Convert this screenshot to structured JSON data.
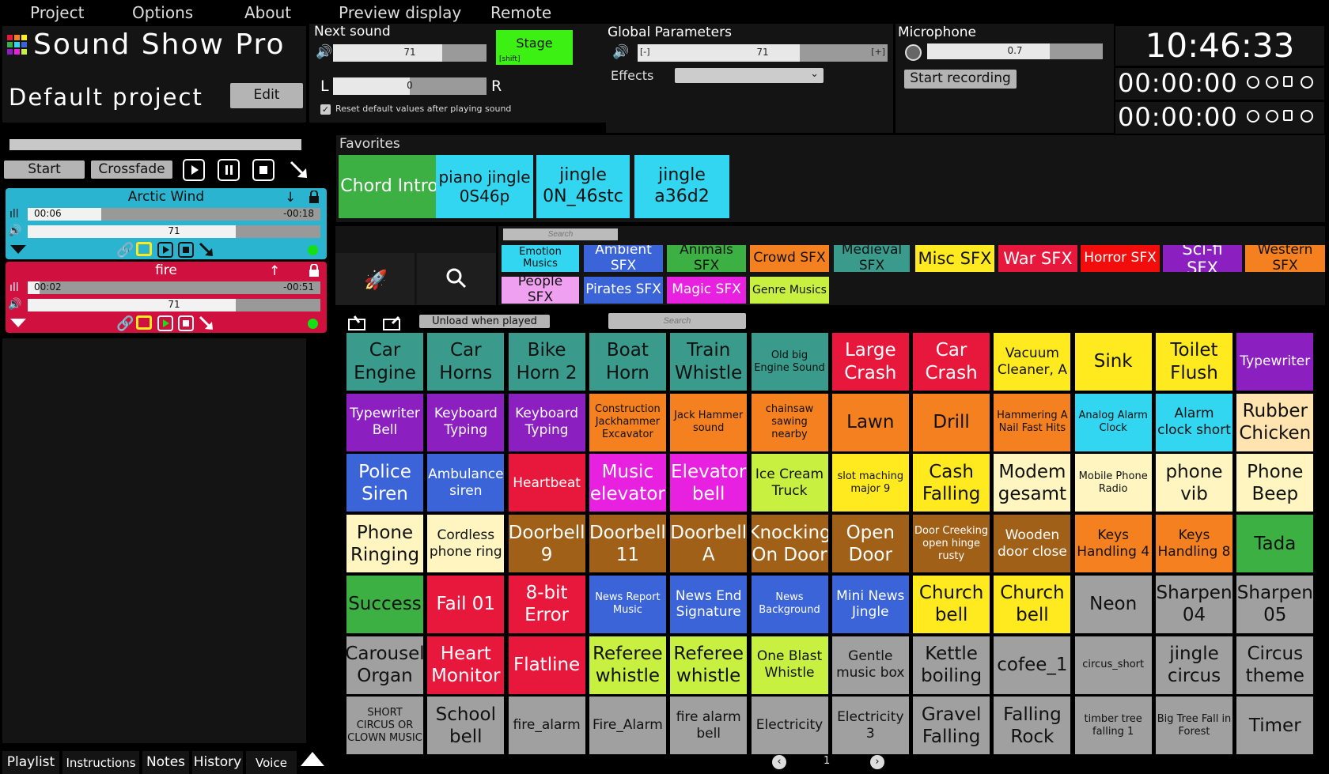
{
  "menu": [
    "Project",
    "Options",
    "About",
    "Preview display",
    "Remote"
  ],
  "app": {
    "title": "Sound Show Pro",
    "project": "Default project",
    "edit_label": "Edit"
  },
  "transport": {
    "start": "Start",
    "crossfade": "Crossfade"
  },
  "next_sound": {
    "title": "Next sound",
    "volume": "71",
    "pan": "0",
    "pan_left": "L",
    "pan_right": "R",
    "stage": "Stage",
    "stage_hint": "[shift]",
    "reset_label": "Reset default values after playing sound"
  },
  "global": {
    "title": "Global Parameters",
    "volume": "71",
    "minus": "[-]",
    "plus": "[+]",
    "effects_label": "Effects",
    "effects_value": ""
  },
  "microphone": {
    "title": "Microphone",
    "level": "0.7",
    "record_label": "Start recording"
  },
  "clock": {
    "time": "10:46:33",
    "timer1": "00:00:00",
    "timer2": "00:00:00"
  },
  "players": [
    {
      "name": "Arctic Wind",
      "elapsed": "00:06",
      "remaining": "-00:18",
      "volume": "71",
      "color": "#2ab4d0",
      "progress": 0.25,
      "vol_fill": 0.71
    },
    {
      "name": "fire",
      "elapsed": "00:02",
      "remaining": "-00:51",
      "volume": "71",
      "color": "#d0103e",
      "progress": 0.04,
      "vol_fill": 0.71
    }
  ],
  "favorites": {
    "title": "Favorites",
    "items": [
      {
        "label": "Chord Intro",
        "color": "#3cb043"
      },
      {
        "label": "piano jingle 0S46p",
        "color": "#33d6f0"
      },
      {
        "label": "jingle 0N_46stc",
        "color": "#33d6f0"
      },
      {
        "label": "jingle a36d2",
        "color": "#33d6f0"
      }
    ]
  },
  "search": {
    "placeholder1": "Search",
    "placeholder2": "Search",
    "unload_label": "Unload when played"
  },
  "categories": [
    {
      "label": "Emotion Musics",
      "color": "#33d6f0"
    },
    {
      "label": "Ambient SFX",
      "color": "#3a64d8"
    },
    {
      "label": "Animals SFX",
      "color": "#3cb043"
    },
    {
      "label": "Crowd SFX",
      "color": "#f58020"
    },
    {
      "label": "Medieval SFX",
      "color": "#3a9b8c"
    },
    {
      "label": "Misc SFX",
      "color": "#ffea20"
    },
    {
      "label": "War SFX",
      "color": "#e8183c"
    },
    {
      "label": "Horror SFX",
      "color": "#f20c0c"
    },
    {
      "label": "Sci-fi SFX",
      "color": "#8c1fc0"
    },
    {
      "label": "Western SFX",
      "color": "#f58020"
    },
    {
      "label": "People SFX",
      "color": "#f0a0f0"
    },
    {
      "label": "Pirates SFX",
      "color": "#3a64d8"
    },
    {
      "label": "Magic SFX",
      "color": "#e820e0"
    },
    {
      "label": "Genre Musics",
      "color": "#c8f040"
    }
  ],
  "grid": [
    [
      {
        "l": "Car Engine",
        "c": "#3a9b8c",
        "s": "l"
      },
      {
        "l": "Car Horns",
        "c": "#3a9b8c",
        "s": "l"
      },
      {
        "l": "Bike Horn 2",
        "c": "#3a9b8c",
        "s": "l"
      },
      {
        "l": "Boat Horn",
        "c": "#3a9b8c",
        "s": "l"
      },
      {
        "l": "Train Whistle",
        "c": "#3a9b8c",
        "s": "l"
      },
      {
        "l": "Old big Engine Sound",
        "c": "#3a9b8c",
        "s": "s"
      },
      {
        "l": "Large Crash",
        "c": "#e8183c",
        "s": "l"
      },
      {
        "l": "Car Crash",
        "c": "#e8183c",
        "s": "l"
      },
      {
        "l": "Vacuum Cleaner, A",
        "c": "#ffea20",
        "s": "m"
      },
      {
        "l": "Sink",
        "c": "#ffea20",
        "s": "l"
      },
      {
        "l": "Toilet Flush",
        "c": "#ffea20",
        "s": "l"
      },
      {
        "l": "Typewriter",
        "c": "#8c1fc0",
        "s": "m"
      }
    ],
    [
      {
        "l": "Typewriter Bell",
        "c": "#8c1fc0",
        "s": "m"
      },
      {
        "l": "Keyboard Typing",
        "c": "#8c1fc0",
        "s": "m"
      },
      {
        "l": "Keyboard Typing",
        "c": "#8c1fc0",
        "s": "m"
      },
      {
        "l": "Construction Jackhammer Excavator",
        "c": "#f58020",
        "s": "s"
      },
      {
        "l": "Jack Hammer sound",
        "c": "#f58020",
        "s": "s"
      },
      {
        "l": "chainsaw sawing nearby",
        "c": "#f58020",
        "s": "s"
      },
      {
        "l": "Lawn",
        "c": "#f58020",
        "s": "l"
      },
      {
        "l": "Drill",
        "c": "#f58020",
        "s": "l"
      },
      {
        "l": "Hammering A Nail Fast Hits",
        "c": "#f58020",
        "s": "s"
      },
      {
        "l": "Analog Alarm Clock",
        "c": "#33d6f0",
        "s": "s"
      },
      {
        "l": "Alarm clock short",
        "c": "#33d6f0",
        "s": "m"
      },
      {
        "l": "Rubber Chicken",
        "c": "#ffe4b0",
        "s": "l"
      }
    ],
    [
      {
        "l": "Police Siren",
        "c": "#3a64d8",
        "s": "l"
      },
      {
        "l": "Ambulance siren",
        "c": "#3a64d8",
        "s": "m"
      },
      {
        "l": "Heartbeat",
        "c": "#e8183c",
        "s": "m"
      },
      {
        "l": "Music elevator",
        "c": "#e820e0",
        "s": "l"
      },
      {
        "l": "Elevator bell",
        "c": "#e820e0",
        "s": "l"
      },
      {
        "l": "Ice Cream Truck",
        "c": "#c8f040",
        "s": "m"
      },
      {
        "l": "slot maching major 9",
        "c": "#ffea20",
        "s": "s"
      },
      {
        "l": "Cash Falling",
        "c": "#ffea20",
        "s": "l"
      },
      {
        "l": "Modem gesamt",
        "c": "#fff5c0",
        "s": "l"
      },
      {
        "l": "Mobile Phone Radio",
        "c": "#fff5c0",
        "s": "s"
      },
      {
        "l": "phone vib",
        "c": "#fff5c0",
        "s": "l"
      },
      {
        "l": "Phone Beep",
        "c": "#fff5c0",
        "s": "l"
      }
    ],
    [
      {
        "l": "Phone Ringing",
        "c": "#fff5c0",
        "s": "l"
      },
      {
        "l": "Cordless phone ring",
        "c": "#fff5c0",
        "s": "m"
      },
      {
        "l": "Doorbell 9",
        "c": "#a06018",
        "s": "l"
      },
      {
        "l": "Doorbell 11",
        "c": "#a06018",
        "s": "l"
      },
      {
        "l": "Doorbell A",
        "c": "#a06018",
        "s": "l"
      },
      {
        "l": "Knocking On Door",
        "c": "#a06018",
        "s": "l"
      },
      {
        "l": "Open Door",
        "c": "#a06018",
        "s": "l"
      },
      {
        "l": "Door Creeking open hinge rusty",
        "c": "#a06018",
        "s": "s"
      },
      {
        "l": "Wooden door close",
        "c": "#a06018",
        "s": "m"
      },
      {
        "l": "Keys Handling 4",
        "c": "#f58020",
        "s": "m"
      },
      {
        "l": "Keys Handling 8",
        "c": "#f58020",
        "s": "m"
      },
      {
        "l": "Tada",
        "c": "#3cb043",
        "s": "l"
      }
    ],
    [
      {
        "l": "Success",
        "c": "#3cb043",
        "s": "l"
      },
      {
        "l": "Fail 01",
        "c": "#e8183c",
        "s": "l"
      },
      {
        "l": "8-bit Error",
        "c": "#e8183c",
        "s": "l"
      },
      {
        "l": "News Report Music",
        "c": "#3a64d8",
        "s": "s"
      },
      {
        "l": "News End Signature",
        "c": "#3a64d8",
        "s": "m"
      },
      {
        "l": "News Background",
        "c": "#3a64d8",
        "s": "s"
      },
      {
        "l": "Mini News Jingle",
        "c": "#3a64d8",
        "s": "m"
      },
      {
        "l": "Church bell",
        "c": "#ffea20",
        "s": "l"
      },
      {
        "l": "Church bell",
        "c": "#ffea20",
        "s": "l"
      },
      {
        "l": "Neon",
        "c": "#a0a0a0",
        "s": "l"
      },
      {
        "l": "Sharpen 04",
        "c": "#a0a0a0",
        "s": "l"
      },
      {
        "l": "Sharpen 05",
        "c": "#a0a0a0",
        "s": "l"
      }
    ],
    [
      {
        "l": "Carousel Organ",
        "c": "#a0a0a0",
        "s": "l"
      },
      {
        "l": "Heart Monitor",
        "c": "#e8183c",
        "s": "l"
      },
      {
        "l": "Flatline",
        "c": "#e8183c",
        "s": "l"
      },
      {
        "l": "Referee whistle",
        "c": "#c8f040",
        "s": "l"
      },
      {
        "l": "Referee whistle",
        "c": "#c8f040",
        "s": "l"
      },
      {
        "l": "One Blast Whistle",
        "c": "#c8f040",
        "s": "m"
      },
      {
        "l": "Gentle music box",
        "c": "#a0a0a0",
        "s": "m"
      },
      {
        "l": "Kettle boiling",
        "c": "#a0a0a0",
        "s": "l"
      },
      {
        "l": "cofee_1",
        "c": "#a0a0a0",
        "s": "l"
      },
      {
        "l": "circus_short",
        "c": "#a0a0a0",
        "s": "s"
      },
      {
        "l": "jingle circus",
        "c": "#a0a0a0",
        "s": "l"
      },
      {
        "l": "Circus theme",
        "c": "#a0a0a0",
        "s": "l"
      }
    ],
    [
      {
        "l": "SHORT CIRCUS OR CLOWN MUSIC",
        "c": "#a0a0a0",
        "s": "s"
      },
      {
        "l": "School bell",
        "c": "#a0a0a0",
        "s": "l"
      },
      {
        "l": "fire_alarm",
        "c": "#a0a0a0",
        "s": "m"
      },
      {
        "l": "Fire_Alarm",
        "c": "#a0a0a0",
        "s": "m"
      },
      {
        "l": "fire alarm bell",
        "c": "#a0a0a0",
        "s": "m"
      },
      {
        "l": "Electricity",
        "c": "#a0a0a0",
        "s": "m"
      },
      {
        "l": "Electricity 3",
        "c": "#a0a0a0",
        "s": "m"
      },
      {
        "l": "Gravel Falling",
        "c": "#a0a0a0",
        "s": "l"
      },
      {
        "l": "Falling Rock",
        "c": "#a0a0a0",
        "s": "l"
      },
      {
        "l": "timber tree falling 1",
        "c": "#a0a0a0",
        "s": "s"
      },
      {
        "l": "Big Tree Fall in Forest",
        "c": "#a0a0a0",
        "s": "s"
      },
      {
        "l": "Timer",
        "c": "#a0a0a0",
        "s": "l"
      }
    ]
  ],
  "pager": {
    "page": "1"
  },
  "bottom_tabs": [
    "Playlist",
    "Instructions",
    "Notes",
    "History",
    "Voice"
  ]
}
